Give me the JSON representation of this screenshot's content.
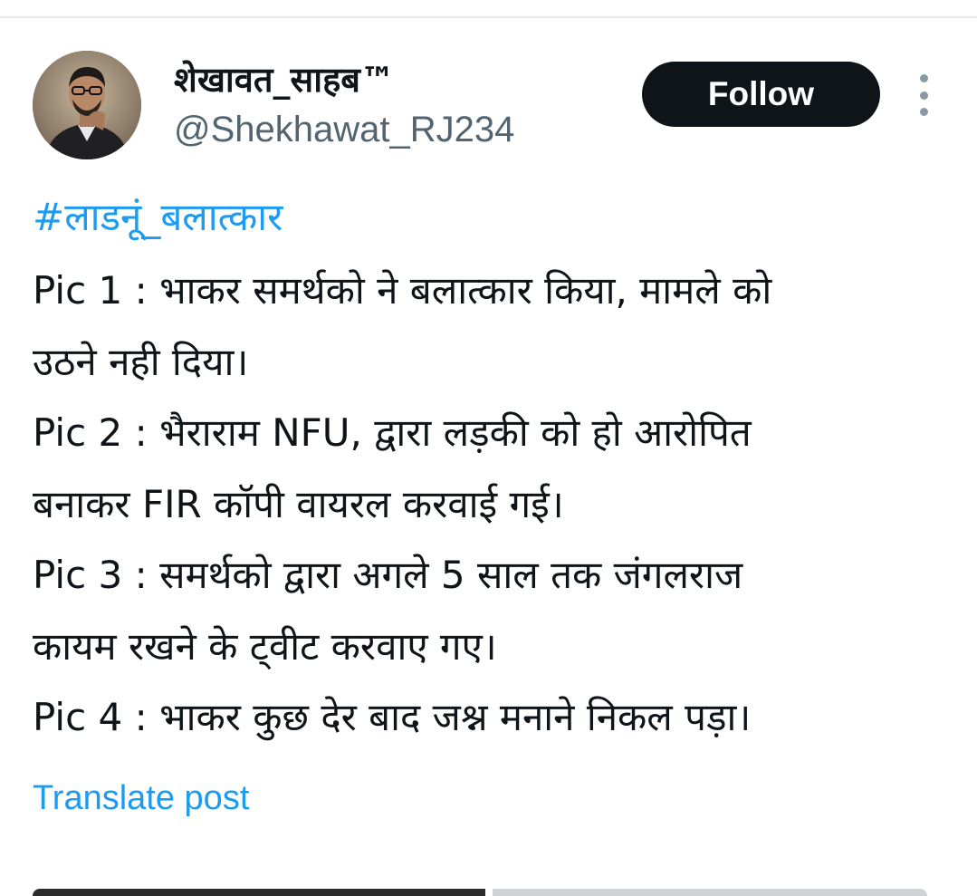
{
  "author": {
    "display_name": "शेखावत_साहब™",
    "handle": "@Shekhawat_RJ234"
  },
  "actions": {
    "follow_label": "Follow",
    "more_icon": "more-vertical-icon"
  },
  "tweet": {
    "hashtag": "#लाडनूं_बलात्कार",
    "lines": [
      "Pic 1 : भाकर समर्थको ने बलात्कार किया, मामले को",
      "उठने नही दिया।",
      "Pic 2 : भैराराम NFU, द्वारा लड़की को हो आरोपित",
      "बनाकर FIR कॉपी वायरल करवाई गई।",
      "Pic 3 : समर्थको द्वारा अगले 5 साल तक जंगलराज",
      "कायम रखने के ट्वीट करवाए गए।",
      "Pic 4 : भाकर कुछ देर बाद जश्न मनाने निकल पड़ा।"
    ],
    "translate_label": "Translate post"
  },
  "colors": {
    "link": "#1d9bf0",
    "text": "#0f1419",
    "secondary": "#536471",
    "follow_bg": "#0f1419"
  }
}
